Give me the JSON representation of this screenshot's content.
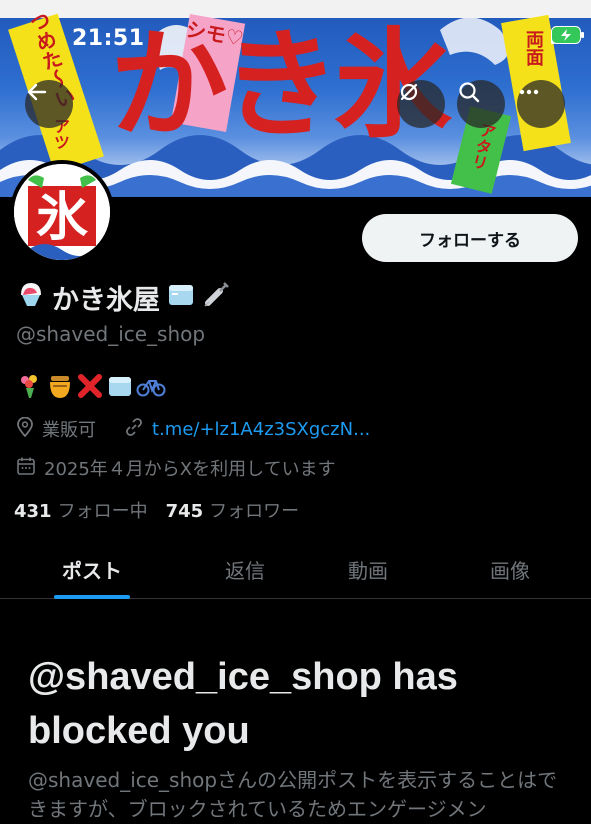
{
  "status_bar": {
    "time": "21:51"
  },
  "banner": {
    "title": "かき氷",
    "flags": [
      "つめた〜い",
      "シモ♡",
      "両面",
      "アタリ",
      "アツ"
    ]
  },
  "icons": {
    "back": "arrow-left-icon",
    "grok": "grok-icon",
    "search": "search-icon",
    "more": "more-icon"
  },
  "profile": {
    "avatar_text": "氷",
    "display_name": "かき氷屋",
    "handle": "@shaved_ice_shop",
    "follow_button": "フォローする",
    "bio_emojis": [
      "💐",
      "🍯",
      "❌",
      "🧊",
      "🚲"
    ],
    "location": "業販可",
    "link": "t.me/+lz1A4z3SXgczN...",
    "joined": "2025年４月からXを利用しています",
    "following_count": "431",
    "following_label": "フォロー中",
    "followers_count": "745",
    "followers_label": "フォロワー"
  },
  "tabs": [
    {
      "label": "ポスト",
      "active": true
    },
    {
      "label": "返信",
      "active": false
    },
    {
      "label": "動画",
      "active": false
    },
    {
      "label": "画像",
      "active": false
    }
  ],
  "blocked": {
    "title": "@shaved_ice_shop has blocked you",
    "description": "@shaved_ice_shopさんの公開ポストを表示することはできますが、ブロックされているためエンゲージメン"
  },
  "colors": {
    "accent": "#1d9bf0",
    "background": "#000000",
    "secondary_text": "#71767b",
    "banner_red": "#d62121"
  }
}
